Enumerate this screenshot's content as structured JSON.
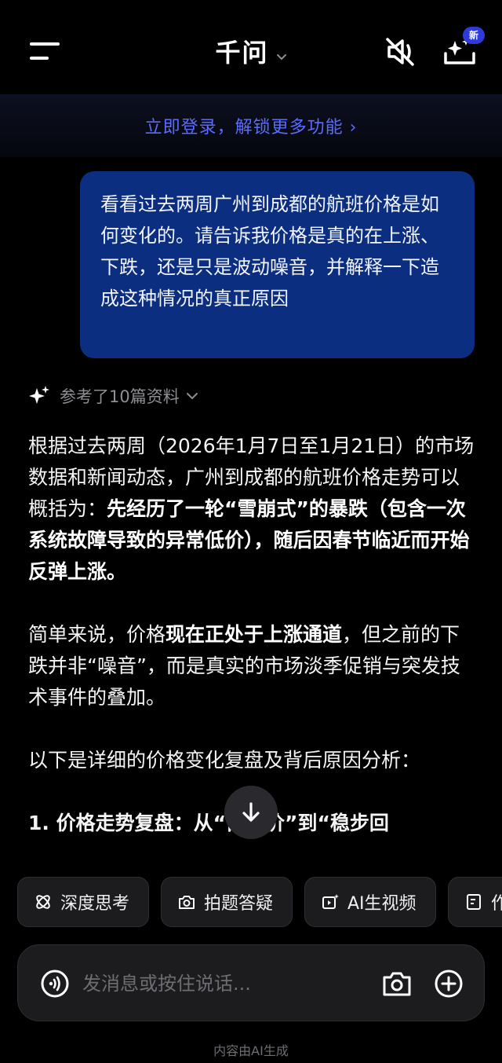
{
  "header": {
    "title": "千问",
    "new_badge": "新"
  },
  "login_bar": {
    "text": "立即登录，解锁更多功能",
    "chevron": "›"
  },
  "user_message": {
    "text": "看看过去两周广州到成都的航班价格是如何变化的。请告诉我价格是真的在上涨、下跌，还是只是波动噪音，并解释一下造成这种情况的真正原因"
  },
  "references": {
    "text": "参考了10篇资料"
  },
  "answer": {
    "p1_a": "根据过去两周（2026年1月7日至1月21日）的市场数据和新闻动态，广州到成都的航班价格走势可以概括为：",
    "p1_b": "先经历了一轮“雪崩式”的暴跌（包含一次系统故障导致的异常低价），随后因春节临近而开始反弹上涨。",
    "p2_a": "简单来说，价格",
    "p2_b": "现在正处于上涨通道",
    "p2_c": "，但之前的下跌并非“噪音”，而是真实的市场淡季促销与突发技术事件的叠加。",
    "p3": "以下是详细的价格变化复盘及背后原因分析：",
    "p4": "1. 价格走势复盘：从“白菜价”到“稳步回"
  },
  "chips": [
    {
      "label": "深度思考"
    },
    {
      "label": "拍题答疑"
    },
    {
      "label": "AI生视频"
    },
    {
      "label": "作"
    }
  ],
  "input": {
    "placeholder": "发消息或按住说话..."
  },
  "footer": {
    "note": "内容由AI生成"
  }
}
